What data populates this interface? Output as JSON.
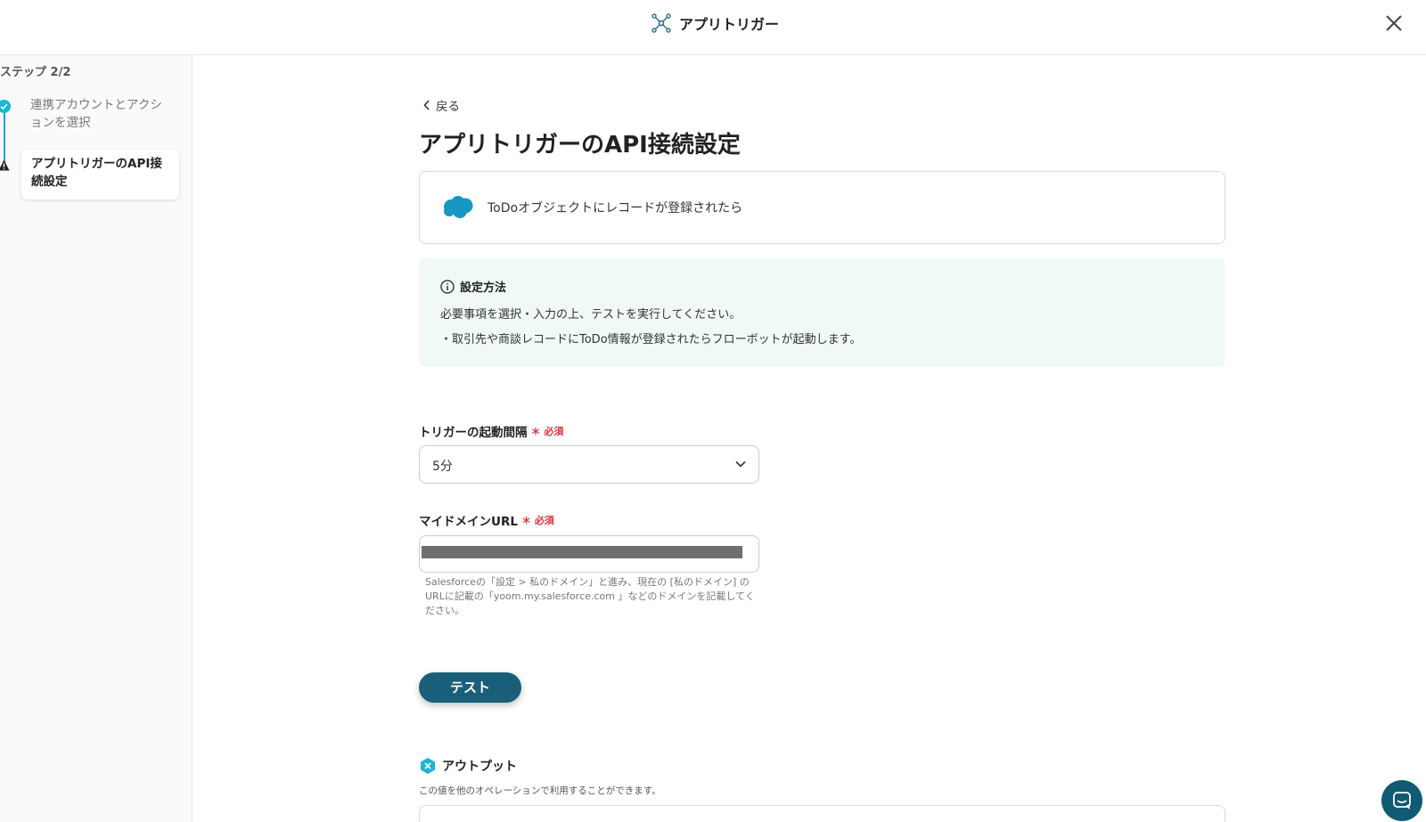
{
  "header": {
    "title": "アプリトリガー",
    "close_icon": "close-icon",
    "logo_icon": "network-icon"
  },
  "sidebar": {
    "step_label": "ステップ 2/2",
    "steps": [
      {
        "label": "連携アカウントとアクションを選択",
        "status": "complete",
        "icon": "check-icon"
      },
      {
        "label": "アプリトリガーのAPI接続設定",
        "status": "warning",
        "icon": "warning-icon"
      }
    ]
  },
  "main": {
    "back_label": "戻る",
    "title": "アプリトリガーのAPI接続設定",
    "app_card": {
      "icon": "salesforce-icon",
      "label": "ToDoオブジェクトにレコードが登録されたら"
    },
    "info": {
      "heading": "設定方法",
      "line1": "必要事項を選択・入力の上、テストを実行してください。",
      "line2": "・取引先や商談レコードにToDo情報が登録されたらフローボットが起動します。"
    },
    "interval_field": {
      "label": "トリガーの起動間隔",
      "required": "必須",
      "value": "5分"
    },
    "domain_field": {
      "label": "マイドメインURL",
      "required": "必須",
      "hint": "Salesforceの「設定 > 私のドメイン」と進み、現在の [私のドメイン] のURLに記載の「yoom.my.salesforce.com 」などのドメインを記載してください。"
    },
    "test_button": "テスト",
    "output": {
      "heading": "アウトプット",
      "description": "この値を他のオペレーションで利用することができます。"
    }
  },
  "colors": {
    "accent": "#1aa6c7",
    "button": "#1a5f79",
    "required": "#e0313b",
    "info_bg": "#f1f9f8",
    "salesforce": "#1798c1"
  }
}
